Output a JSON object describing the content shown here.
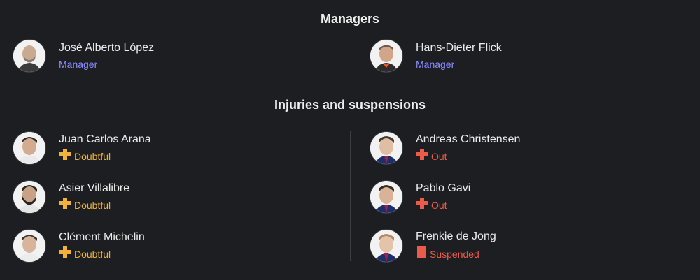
{
  "managers": {
    "title": "Managers",
    "items": [
      {
        "name": "José Alberto López",
        "role": "Manager"
      },
      {
        "name": "Hans-Dieter Flick",
        "role": "Manager"
      }
    ]
  },
  "injuries": {
    "title": "Injuries and suspensions",
    "left": [
      {
        "name": "Juan Carlos Arana",
        "status": "Doubtful",
        "icon": "plus-icon",
        "color": "#f0b23a"
      },
      {
        "name": "Asier Villalibre",
        "status": "Doubtful",
        "icon": "plus-icon",
        "color": "#f0b23a"
      },
      {
        "name": "Clément Michelin",
        "status": "Doubtful",
        "icon": "plus-icon",
        "color": "#f0b23a"
      }
    ],
    "right": [
      {
        "name": "Andreas Christensen",
        "status": "Out",
        "icon": "plus-icon",
        "color": "#ec5a4a"
      },
      {
        "name": "Pablo Gavi",
        "status": "Out",
        "icon": "plus-icon",
        "color": "#ec5a4a"
      },
      {
        "name": "Frenkie de Jong",
        "status": "Suspended",
        "icon": "red-card-icon",
        "color": "#ec5a4a"
      }
    ]
  },
  "colors": {
    "background": "#1c1e21",
    "role_accent": "#8b8cff",
    "doubtful": "#f0b23a",
    "out": "#ec5a4a"
  }
}
